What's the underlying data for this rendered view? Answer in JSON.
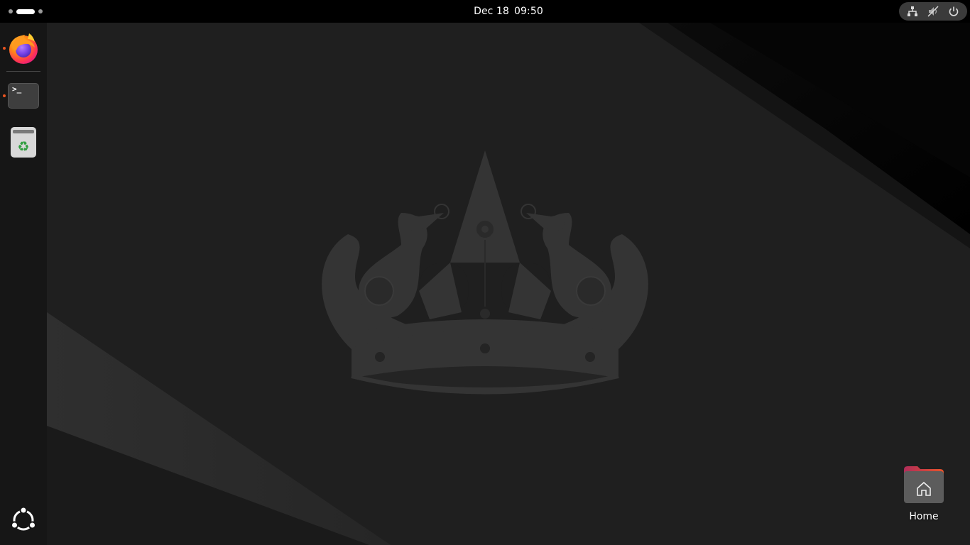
{
  "topbar": {
    "date": "Dec 18",
    "time": "09:50",
    "tray": {
      "network_icon": "network-wired-icon",
      "volume_icon": "volume-muted-icon",
      "power_icon": "power-icon"
    }
  },
  "dock": {
    "items": [
      {
        "name": "Firefox",
        "icon": "firefox-icon",
        "running": true
      },
      {
        "name": "Terminal",
        "icon": "terminal-icon",
        "running": true,
        "prompt": ">_"
      },
      {
        "name": "Trash",
        "icon": "trash-icon",
        "running": false
      }
    ],
    "app_grid_icon": "ubuntu-logo-icon"
  },
  "desktop": {
    "icons": [
      {
        "label": "Home",
        "icon": "home-folder-icon"
      }
    ]
  },
  "colors": {
    "accent": "#e95420",
    "topbar": "#000000",
    "dock": "#161616",
    "wallpaper": "#1f1f1f"
  }
}
